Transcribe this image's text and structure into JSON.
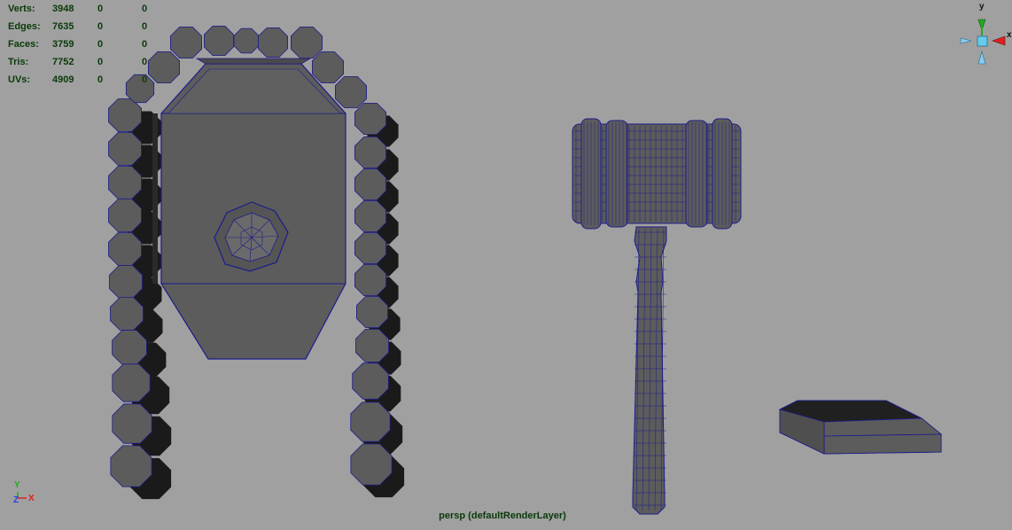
{
  "stats": [
    {
      "label": "Verts:",
      "c1": "3948",
      "c2": "0",
      "c3": "0"
    },
    {
      "label": "Edges:",
      "c1": "7635",
      "c2": "0",
      "c3": "0"
    },
    {
      "label": "Faces:",
      "c1": "3759",
      "c2": "0",
      "c3": "0"
    },
    {
      "label": "Tris:",
      "c1": "7752",
      "c2": "0",
      "c3": "0"
    },
    {
      "label": "UVs:",
      "c1": "4909",
      "c2": "0",
      "c3": "0"
    }
  ],
  "camera_label": "persp (defaultRenderLayer)",
  "view_cube": {
    "y": "y",
    "x": "x"
  },
  "axis_indicator": {
    "y": "Y",
    "z": "Z",
    "x": "X"
  },
  "colors": {
    "background": "#a0a0a0",
    "mesh_face": "#5c5c5c",
    "mesh_shadow": "#1a1a1a",
    "wireframe": "#1c1c8c",
    "hud_text": "#0a3a0a",
    "axis_y": "#22aa22",
    "axis_x": "#dd2222",
    "axis_z": "#2244dd",
    "cube_face": "#66ccee"
  }
}
